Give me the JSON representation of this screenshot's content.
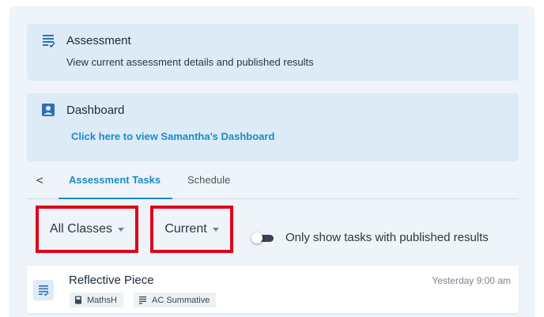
{
  "assessment_card": {
    "title": "Assessment",
    "description": "View current assessment details and published results",
    "icon": "assessment-list-icon"
  },
  "dashboard_card": {
    "title": "Dashboard",
    "link": "Click here to view Samantha's Dashboard",
    "icon": "person-badge-icon"
  },
  "tabs": {
    "back": "<",
    "items": [
      {
        "label": "Assessment Tasks",
        "active": true
      },
      {
        "label": "Schedule",
        "active": false
      }
    ]
  },
  "filters": {
    "classes": "All Classes",
    "period": "Current",
    "toggle_label": "Only show tasks with published results",
    "toggle_on": false
  },
  "tasks": [
    {
      "title": "Reflective Piece",
      "time": "Yesterday 9:00 am",
      "subject": "MathsH",
      "type": "AC Summative"
    }
  ],
  "colors": {
    "accent": "#1a8cc6",
    "highlight": "#e0001b",
    "card": "#dcebf6"
  }
}
